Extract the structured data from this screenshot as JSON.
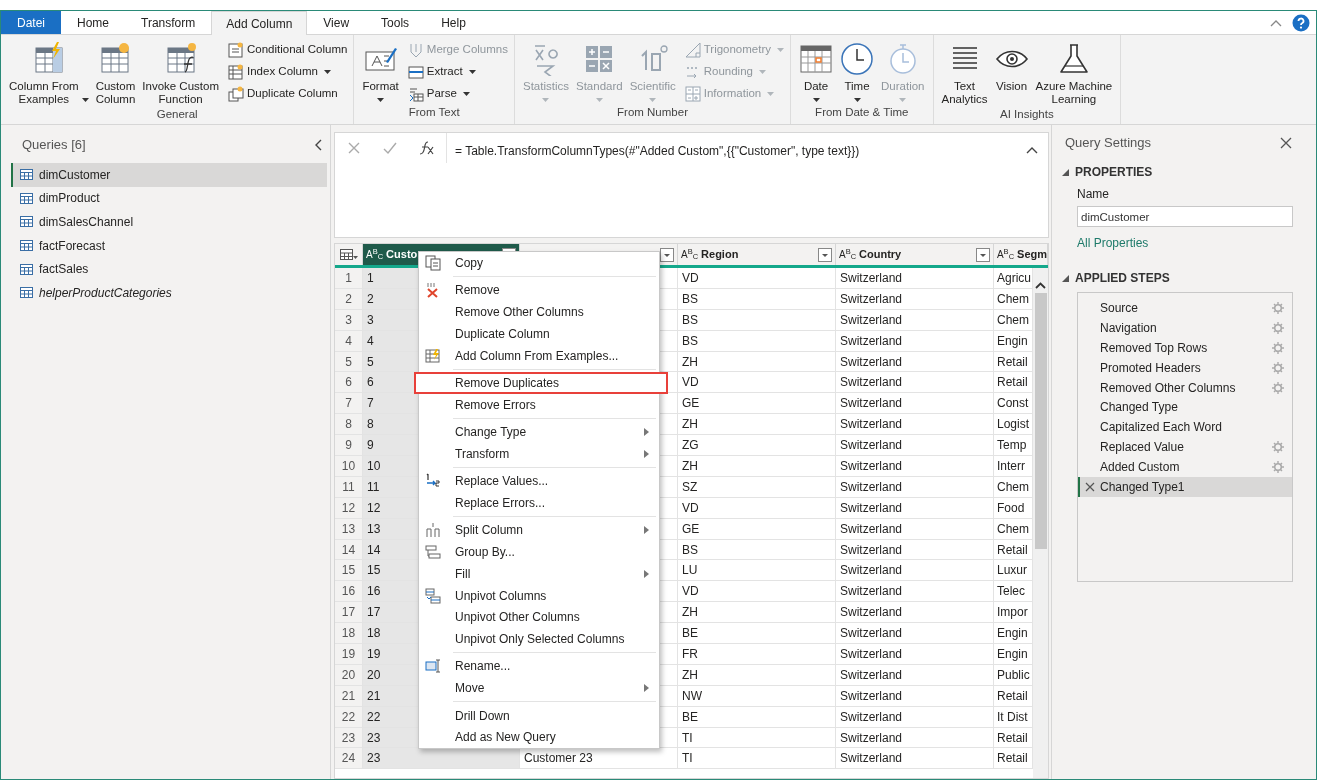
{
  "tabs": [
    {
      "label": "Datei",
      "kind": "file",
      "selected": false
    },
    {
      "label": "Home",
      "kind": "tab",
      "selected": false
    },
    {
      "label": "Transform",
      "kind": "tab",
      "selected": false
    },
    {
      "label": "Add Column",
      "kind": "tab",
      "selected": true
    },
    {
      "label": "View",
      "kind": "tab",
      "selected": false
    },
    {
      "label": "Tools",
      "kind": "tab",
      "selected": false
    },
    {
      "label": "Help",
      "kind": "tab",
      "selected": false
    }
  ],
  "ribbon": {
    "groups": [
      {
        "title": "General",
        "buttons": [
          {
            "kind": "large",
            "label": "Column From\nExamples",
            "dropdown": true,
            "disabled": false
          },
          {
            "kind": "large",
            "label": "Custom\nColumn",
            "dropdown": false,
            "disabled": false
          },
          {
            "kind": "large",
            "label": "Invoke Custom\nFunction",
            "dropdown": false,
            "disabled": false
          },
          {
            "kind": "small",
            "label": "Conditional Column",
            "dropdown": false,
            "disabled": false
          },
          {
            "kind": "small",
            "label": "Index Column",
            "dropdown": true,
            "disabled": false
          },
          {
            "kind": "small",
            "label": "Duplicate Column",
            "dropdown": false,
            "disabled": false
          }
        ]
      },
      {
        "title": "From Text",
        "buttons": [
          {
            "kind": "large",
            "label": "Format",
            "dropdown": true,
            "disabled": false
          },
          {
            "kind": "small",
            "label": "Merge Columns",
            "dropdown": false,
            "disabled": true
          },
          {
            "kind": "small",
            "label": "Extract",
            "dropdown": true,
            "disabled": false
          },
          {
            "kind": "small",
            "label": "Parse",
            "dropdown": true,
            "disabled": false
          }
        ]
      },
      {
        "title": "From Number",
        "buttons": [
          {
            "kind": "large",
            "label": "Statistics",
            "dropdown": true,
            "disabled": true
          },
          {
            "kind": "large",
            "label": "Standard",
            "dropdown": true,
            "disabled": true
          },
          {
            "kind": "large",
            "label": "Scientific",
            "dropdown": true,
            "disabled": true
          },
          {
            "kind": "small",
            "label": "Trigonometry",
            "dropdown": true,
            "disabled": true
          },
          {
            "kind": "small",
            "label": "Rounding",
            "dropdown": true,
            "disabled": true
          },
          {
            "kind": "small",
            "label": "Information",
            "dropdown": true,
            "disabled": true
          }
        ]
      },
      {
        "title": "From Date & Time",
        "buttons": [
          {
            "kind": "large",
            "label": "Date",
            "dropdown": true,
            "disabled": false
          },
          {
            "kind": "large",
            "label": "Time",
            "dropdown": true,
            "disabled": false
          },
          {
            "kind": "large",
            "label": "Duration",
            "dropdown": true,
            "disabled": true
          }
        ]
      },
      {
        "title": "AI Insights",
        "buttons": [
          {
            "kind": "large",
            "label": "Text\nAnalytics",
            "dropdown": false,
            "disabled": false
          },
          {
            "kind": "large",
            "label": "Vision",
            "dropdown": false,
            "disabled": false
          },
          {
            "kind": "large",
            "label": "Azure Machine\nLearning",
            "dropdown": false,
            "disabled": false
          }
        ]
      }
    ]
  },
  "queries": {
    "title": "Queries [6]",
    "items": [
      {
        "name": "dimCustomer",
        "selected": true,
        "loaded": true
      },
      {
        "name": "dimProduct",
        "selected": false,
        "loaded": true
      },
      {
        "name": "dimSalesChannel",
        "selected": false,
        "loaded": true
      },
      {
        "name": "factForecast",
        "selected": false,
        "loaded": true
      },
      {
        "name": "factSales",
        "selected": false,
        "loaded": true
      },
      {
        "name": "helperProductCategories",
        "selected": false,
        "loaded": false
      }
    ]
  },
  "formula_bar": {
    "formula": "= Table.TransformColumnTypes(#\"Added Custom\",{{\"Customer\", type text}})"
  },
  "grid": {
    "columns": [
      {
        "type": "A$^{B}$$_{C}$",
        "name": "Custo",
        "selected": true
      },
      {
        "type": "A$^{B}$$_{C}$",
        "name": "Region",
        "selected": false
      },
      {
        "type": "A$^{B}$$_{C}$",
        "name": "Country",
        "selected": false
      },
      {
        "type": "A$^{B}$$_{C}$",
        "name": "Segm",
        "selected": false
      }
    ],
    "rows": [
      {
        "number": "1",
        "id": "1",
        "region": "VD",
        "country": "Switzerland",
        "segment": "Agricu"
      },
      {
        "number": "2",
        "id": "2",
        "region": "BS",
        "country": "Switzerland",
        "segment": "Chem"
      },
      {
        "number": "3",
        "id": "3",
        "region": "BS",
        "country": "Switzerland",
        "segment": "Chem"
      },
      {
        "number": "4",
        "id": "4",
        "region": "BS",
        "country": "Switzerland",
        "segment": "Engin"
      },
      {
        "number": "5",
        "id": "5",
        "region": "ZH",
        "country": "Switzerland",
        "segment": "Retail"
      },
      {
        "number": "6",
        "id": "6",
        "region": "VD",
        "country": "Switzerland",
        "segment": "Retail"
      },
      {
        "number": "7",
        "id": "7",
        "region": "GE",
        "country": "Switzerland",
        "segment": "Const"
      },
      {
        "number": "8",
        "id": "8",
        "region": "ZH",
        "country": "Switzerland",
        "segment": "Logist"
      },
      {
        "number": "9",
        "id": "9",
        "region": "ZG",
        "country": "Switzerland",
        "segment": "Temp"
      },
      {
        "number": "10",
        "id": "10",
        "region": "ZH",
        "country": "Switzerland",
        "segment": "Interr"
      },
      {
        "number": "11",
        "id": "11",
        "region": "SZ",
        "country": "Switzerland",
        "segment": "Chem"
      },
      {
        "number": "12",
        "id": "12",
        "region": "VD",
        "country": "Switzerland",
        "segment": "Food"
      },
      {
        "number": "13",
        "id": "13",
        "region": "GE",
        "country": "Switzerland",
        "segment": "Chem"
      },
      {
        "number": "14",
        "id": "14",
        "region": "BS",
        "country": "Switzerland",
        "segment": "Retail"
      },
      {
        "number": "15",
        "id": "15",
        "region": "LU",
        "country": "Switzerland",
        "segment": "Luxur"
      },
      {
        "number": "16",
        "id": "16",
        "region": "VD",
        "country": "Switzerland",
        "segment": "Telec"
      },
      {
        "number": "17",
        "id": "17",
        "region": "ZH",
        "country": "Switzerland",
        "segment": "Impor"
      },
      {
        "number": "18",
        "id": "18",
        "region": "BE",
        "country": "Switzerland",
        "segment": "Engin"
      },
      {
        "number": "19",
        "id": "19",
        "region": "FR",
        "country": "Switzerland",
        "segment": "Engin"
      },
      {
        "number": "20",
        "id": "20",
        "region": "ZH",
        "country": "Switzerland",
        "segment": "Public"
      },
      {
        "number": "21",
        "id": "21",
        "region": "NW",
        "country": "Switzerland",
        "segment": "Retail"
      },
      {
        "number": "22",
        "id": "22",
        "region": "BE",
        "country": "Switzerland",
        "segment": "It Dist"
      },
      {
        "number": "23",
        "id": "23",
        "region": "TI",
        "country": "Switzerland",
        "segment": "Retail"
      },
      {
        "number": "24",
        "id": "23",
        "name": "Customer 23",
        "region": "TI",
        "country": "Switzerland",
        "segment": "Retail"
      }
    ]
  },
  "context_menu": {
    "groups": [
      [
        {
          "label": "Copy",
          "submenu": false,
          "highlighted": false
        }
      ],
      [
        {
          "label": "Remove",
          "submenu": false,
          "highlighted": false
        },
        {
          "label": "Remove Other Columns",
          "submenu": false,
          "highlighted": false
        },
        {
          "label": "Duplicate Column",
          "submenu": false,
          "highlighted": false
        },
        {
          "label": "Add Column From Examples...",
          "submenu": false,
          "highlighted": false
        }
      ],
      [
        {
          "label": "Remove Duplicates",
          "submenu": false,
          "highlighted": true
        },
        {
          "label": "Remove Errors",
          "submenu": false,
          "highlighted": false
        }
      ],
      [
        {
          "label": "Change Type",
          "submenu": true,
          "highlighted": false
        },
        {
          "label": "Transform",
          "submenu": true,
          "highlighted": false
        }
      ],
      [
        {
          "label": "Replace Values...",
          "submenu": false,
          "highlighted": false
        },
        {
          "label": "Replace Errors...",
          "submenu": false,
          "highlighted": false
        }
      ],
      [
        {
          "label": "Split Column",
          "submenu": true,
          "highlighted": false
        },
        {
          "label": "Group By...",
          "submenu": false,
          "highlighted": false
        },
        {
          "label": "Fill",
          "submenu": true,
          "highlighted": false
        },
        {
          "label": "Unpivot Columns",
          "submenu": false,
          "highlighted": false
        },
        {
          "label": "Unpivot Other Columns",
          "submenu": false,
          "highlighted": false
        },
        {
          "label": "Unpivot Only Selected Columns",
          "submenu": false,
          "highlighted": false
        }
      ],
      [
        {
          "label": "Rename...",
          "submenu": false,
          "highlighted": false
        },
        {
          "label": "Move",
          "submenu": true,
          "highlighted": false
        }
      ],
      [
        {
          "label": "Drill Down",
          "submenu": false,
          "highlighted": false
        },
        {
          "label": "Add as New Query",
          "submenu": false,
          "highlighted": false
        }
      ]
    ]
  },
  "query_settings": {
    "title": "Query Settings",
    "properties_heading": "PROPERTIES",
    "name_label": "Name",
    "name_value": "dimCustomer",
    "all_properties": "All Properties",
    "steps_heading": "APPLIED STEPS",
    "steps": [
      {
        "label": "Source",
        "settings": true,
        "selected": false
      },
      {
        "label": "Navigation",
        "settings": true,
        "selected": false
      },
      {
        "label": "Removed Top Rows",
        "settings": true,
        "selected": false
      },
      {
        "label": "Promoted Headers",
        "settings": true,
        "selected": false
      },
      {
        "label": "Removed Other Columns",
        "settings": true,
        "selected": false
      },
      {
        "label": "Changed Type",
        "settings": false,
        "selected": false
      },
      {
        "label": "Capitalized Each Word",
        "settings": false,
        "selected": false
      },
      {
        "label": "Replaced Value",
        "settings": true,
        "selected": false
      },
      {
        "label": "Added Custom",
        "settings": true,
        "selected": false
      },
      {
        "label": "Changed Type1",
        "settings": false,
        "selected": true
      }
    ]
  }
}
